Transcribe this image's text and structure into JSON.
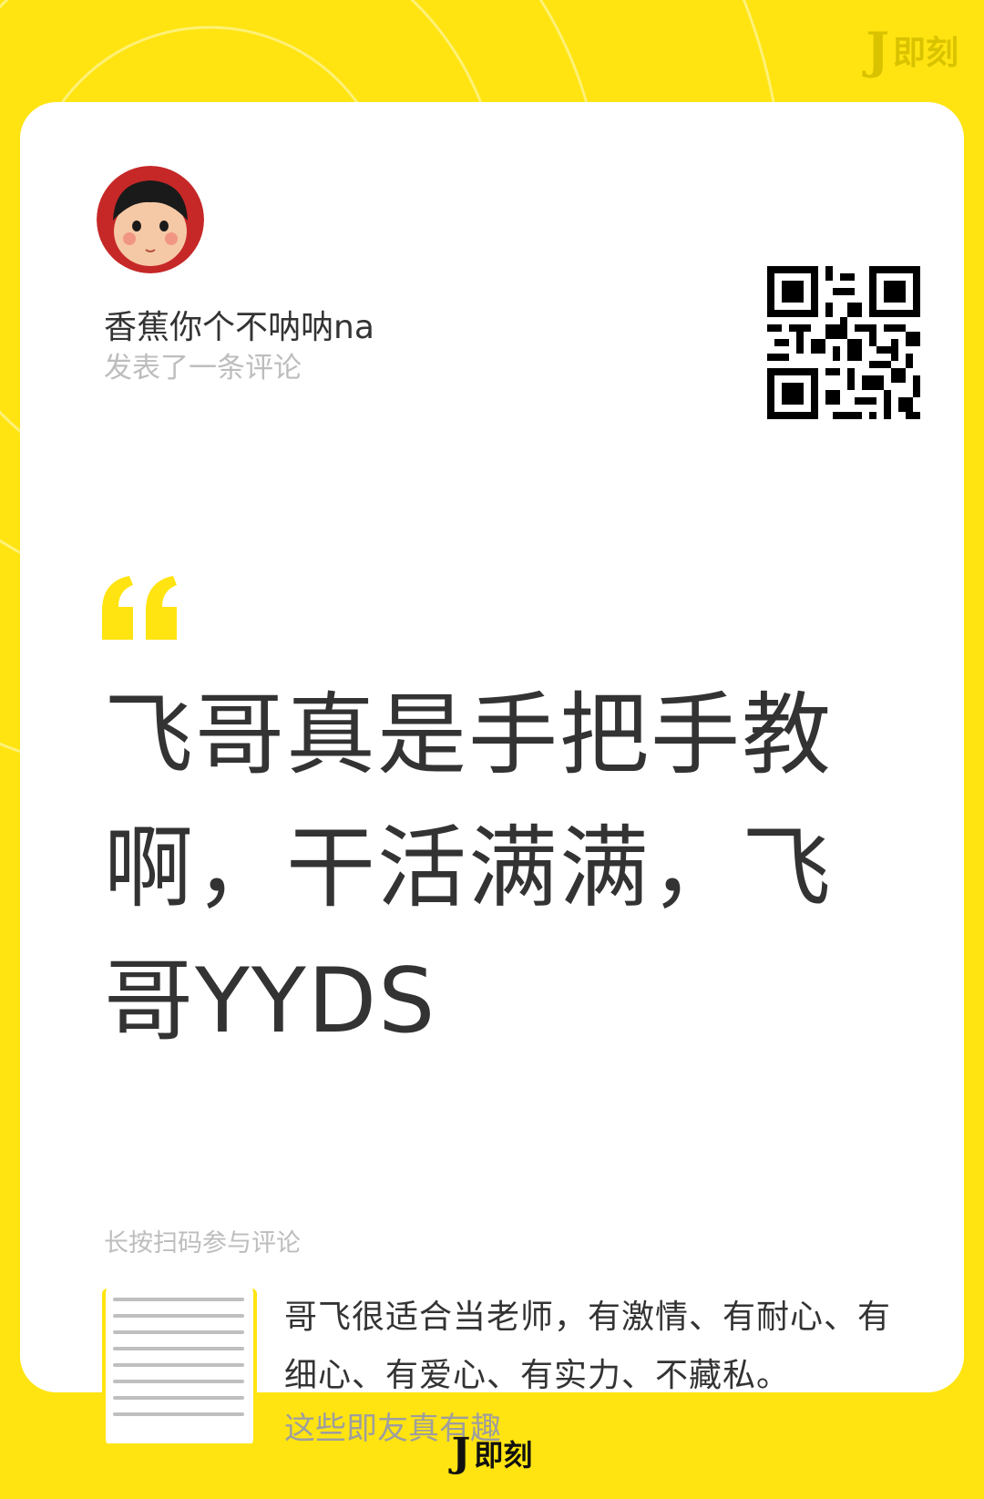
{
  "brand": {
    "mark": "J",
    "name": "即刻",
    "accent": "#FFE411",
    "text_color": "#333333",
    "muted_color": "#BDBDBD"
  },
  "author": {
    "name": "香蕉你个不呐呐na",
    "action": "发表了一条评论",
    "avatar": "avatar-icon"
  },
  "qr": {
    "icon": "qr-code-icon"
  },
  "comment": {
    "text": "飞哥真是手把手教啊，干活满满，飞哥YYDS"
  },
  "footer": {
    "hint": "长按扫码参与评论",
    "original_post": "哥飞很适合当老师，有激情、有耐心、有细心、有爱心、有实力、不藏私。",
    "topic": "这些即友真有趣"
  }
}
